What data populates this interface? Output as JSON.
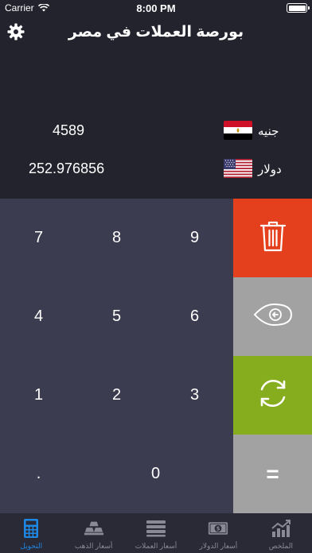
{
  "status_bar": {
    "carrier": "Carrier",
    "time": "8:00 PM",
    "battery_level": 1.0
  },
  "header": {
    "title": "بورصة العملات في مصر",
    "settings_icon": "gear-icon"
  },
  "converter": {
    "rows": [
      {
        "currency": "جنيه",
        "value": "4589",
        "flag": "egypt-flag"
      },
      {
        "currency": "دولار",
        "value": "252.976856",
        "flag": "us-flag"
      }
    ]
  },
  "keypad": {
    "keys": [
      "7",
      "8",
      "9",
      "4",
      "5",
      "6",
      "1",
      "2",
      "3",
      ".",
      "0"
    ]
  },
  "operations": {
    "clear_icon": "trash-icon",
    "backspace_icon": "backspace-icon",
    "swap_icon": "refresh-icon",
    "equals_label": "=",
    "colors": {
      "clear": "#e5401e",
      "backspace": "#a2a2a2",
      "swap": "#86ad1d",
      "equals": "#a2a2a2"
    }
  },
  "tabbar": {
    "tabs": [
      {
        "label": "التحويل",
        "icon": "calculator-icon",
        "active": true
      },
      {
        "label": "أسعار الذهب",
        "icon": "gold-bars-icon",
        "active": false
      },
      {
        "label": "أسعار العملات",
        "icon": "list-icon",
        "active": false
      },
      {
        "label": "أسعار الدولار",
        "icon": "dollar-bill-icon",
        "active": false
      },
      {
        "label": "الملخص",
        "icon": "chart-icon",
        "active": false
      }
    ],
    "active_color": "#1e88e5"
  }
}
